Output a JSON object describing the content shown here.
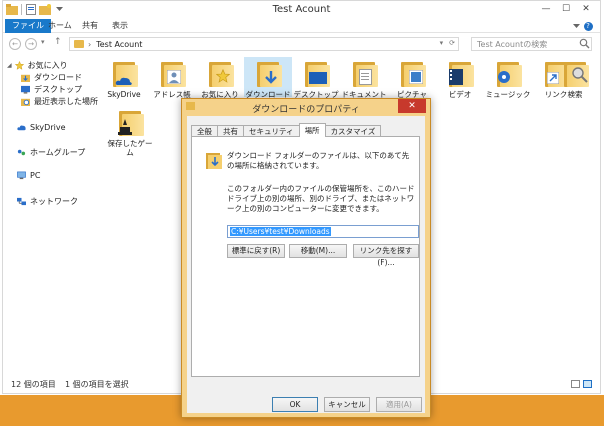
{
  "window": {
    "title": "Test Acount",
    "controls": {
      "minimize": "—",
      "maximize": "☐",
      "close": "✕"
    }
  },
  "ribbon": {
    "tabs": [
      {
        "label": "ファイル",
        "active": true
      },
      {
        "label": "ホーム"
      },
      {
        "label": "共有"
      },
      {
        "label": "表示"
      }
    ],
    "expand_icon": "chevron-down-icon",
    "help_label": "?"
  },
  "navigation": {
    "back": "←",
    "forward": "→",
    "recent": "▾",
    "up": "↑",
    "address_path": "Test Acount",
    "address_dropdown": "▾",
    "refresh": "⟳",
    "search_placeholder": "Test Acountの検索"
  },
  "nav_pane": {
    "favorites": "お気に入り",
    "favorite_items": [
      "ダウンロード",
      "デスクトップ",
      "最近表示した場所"
    ],
    "skydrive": "SkyDrive",
    "homegroup": "ホームグループ",
    "pc": "PC",
    "network": "ネットワーク"
  },
  "folders": [
    {
      "label": "SkyDrive",
      "icon": "skydrive-folder-icon"
    },
    {
      "label": "アドレス帳",
      "icon": "contacts-folder-icon"
    },
    {
      "label": "お気に入り",
      "icon": "favorites-folder-icon"
    },
    {
      "label": "ダウンロード",
      "icon": "downloads-folder-icon",
      "selected": true
    },
    {
      "label": "デスクトップ",
      "icon": "desktop-folder-icon"
    },
    {
      "label": "ドキュメント",
      "icon": "documents-folder-icon"
    },
    {
      "label": "ピクチャ",
      "icon": "pictures-folder-icon"
    },
    {
      "label": "ビデオ",
      "icon": "videos-folder-icon"
    },
    {
      "label": "ミュージック",
      "icon": "music-folder-icon"
    },
    {
      "label": "リンク",
      "icon": "links-folder-icon"
    },
    {
      "label": "検索",
      "icon": "searches-folder-icon"
    },
    {
      "label": "保存したゲーム",
      "icon": "saved-games-folder-icon"
    }
  ],
  "status": {
    "item_count": "12 個の項目",
    "selected_count": "1 個の項目を選択"
  },
  "dialog": {
    "title": "ダウンロードのプロパティ",
    "close": "✕",
    "tabs": [
      {
        "label": "全般"
      },
      {
        "label": "共有"
      },
      {
        "label": "セキュリティ"
      },
      {
        "label": "場所",
        "active": true
      },
      {
        "label": "カスタマイズ"
      }
    ],
    "info_text": "ダウンロード フォルダーのファイルは、以下のあて先の場所に格納されています。",
    "description": "このフォルダー内のファイルの保管場所を、このハード ドライブ上の別の場所、別のドライブ、またはネットワーク上の別のコンピューターに変更できます。",
    "path_value": "C:¥Users¥test¥Downloads",
    "restore_default": "標準に戻す(R)",
    "move": "移動(M)...",
    "find_target": "リンク先を探す(F)...",
    "ok": "OK",
    "cancel": "キャンセル",
    "apply": "適用(A)"
  },
  "colors": {
    "accent": "#1979ca",
    "taskbar": "#e89a2e",
    "dialog_frame": "#f5d28a",
    "close_button": "#c7392c",
    "folder": "#f5cf6e"
  }
}
